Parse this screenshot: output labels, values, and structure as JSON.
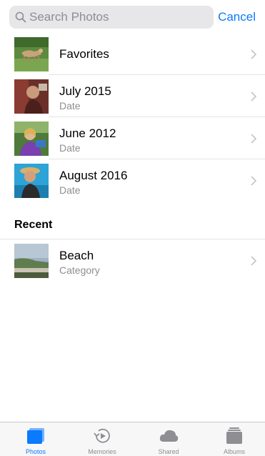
{
  "search": {
    "placeholder": "Search Photos",
    "cancel_label": "Cancel"
  },
  "results": [
    {
      "title": "Favorites",
      "subtitle": ""
    },
    {
      "title": "July 2015",
      "subtitle": "Date"
    },
    {
      "title": "June 2012",
      "subtitle": "Date"
    },
    {
      "title": "August 2016",
      "subtitle": "Date"
    }
  ],
  "recent": {
    "header": "Recent",
    "items": [
      {
        "title": "Beach",
        "subtitle": "Category"
      }
    ]
  },
  "tabs": [
    {
      "label": "Photos",
      "icon": "photos-icon",
      "active": true
    },
    {
      "label": "Memories",
      "icon": "memories-icon",
      "active": false
    },
    {
      "label": "Shared",
      "icon": "shared-cloud-icon",
      "active": false
    },
    {
      "label": "Albums",
      "icon": "albums-icon",
      "active": false
    }
  ],
  "colors": {
    "accent": "#0a7aff",
    "inactive": "#8e8e93",
    "search_field": "#e7e7ea"
  }
}
